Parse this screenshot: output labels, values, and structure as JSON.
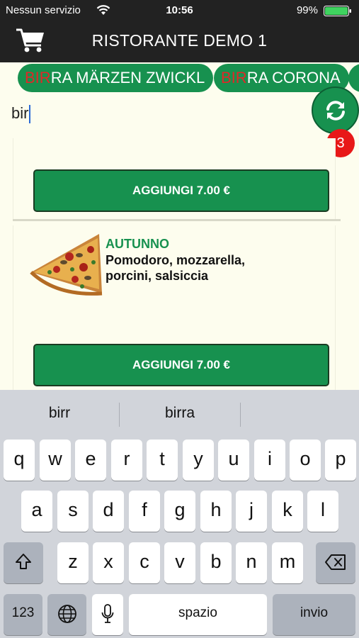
{
  "status": {
    "carrier": "Nessun servizio",
    "time": "10:56",
    "battery": "99%"
  },
  "header": {
    "title": "RISTORANTE DEMO 1",
    "cart_icon": "cart-icon"
  },
  "chips": [
    {
      "highlight": "BIR",
      "rest": "RA MÄRZEN ZWICKL"
    },
    {
      "highlight": "BIR",
      "rest": "RA CORONA"
    }
  ],
  "search": {
    "value": "bir"
  },
  "refresh": {
    "icon": "refresh-icon",
    "badge": "3"
  },
  "colors": {
    "accent": "#17914f",
    "highlight": "#e02828",
    "badge": "#e81818",
    "background": "#fdfdee",
    "bar": "#222222"
  },
  "items": [
    {
      "add_label": "AGGIUNGI 7.00 €"
    },
    {
      "name": "AUTUNNO",
      "description": "Pomodoro, mozzarella, porcini, salsiccia",
      "add_label": "AGGIUNGI 7.00 €"
    }
  ],
  "keyboard": {
    "suggestions": [
      "birr",
      "birra"
    ],
    "row1": [
      "q",
      "w",
      "e",
      "r",
      "t",
      "y",
      "u",
      "i",
      "o",
      "p"
    ],
    "row2": [
      "a",
      "s",
      "d",
      "f",
      "g",
      "h",
      "j",
      "k",
      "l"
    ],
    "row3": [
      "z",
      "x",
      "c",
      "v",
      "b",
      "n",
      "m"
    ],
    "numbers": "123",
    "space": "spazio",
    "return": "invio"
  }
}
